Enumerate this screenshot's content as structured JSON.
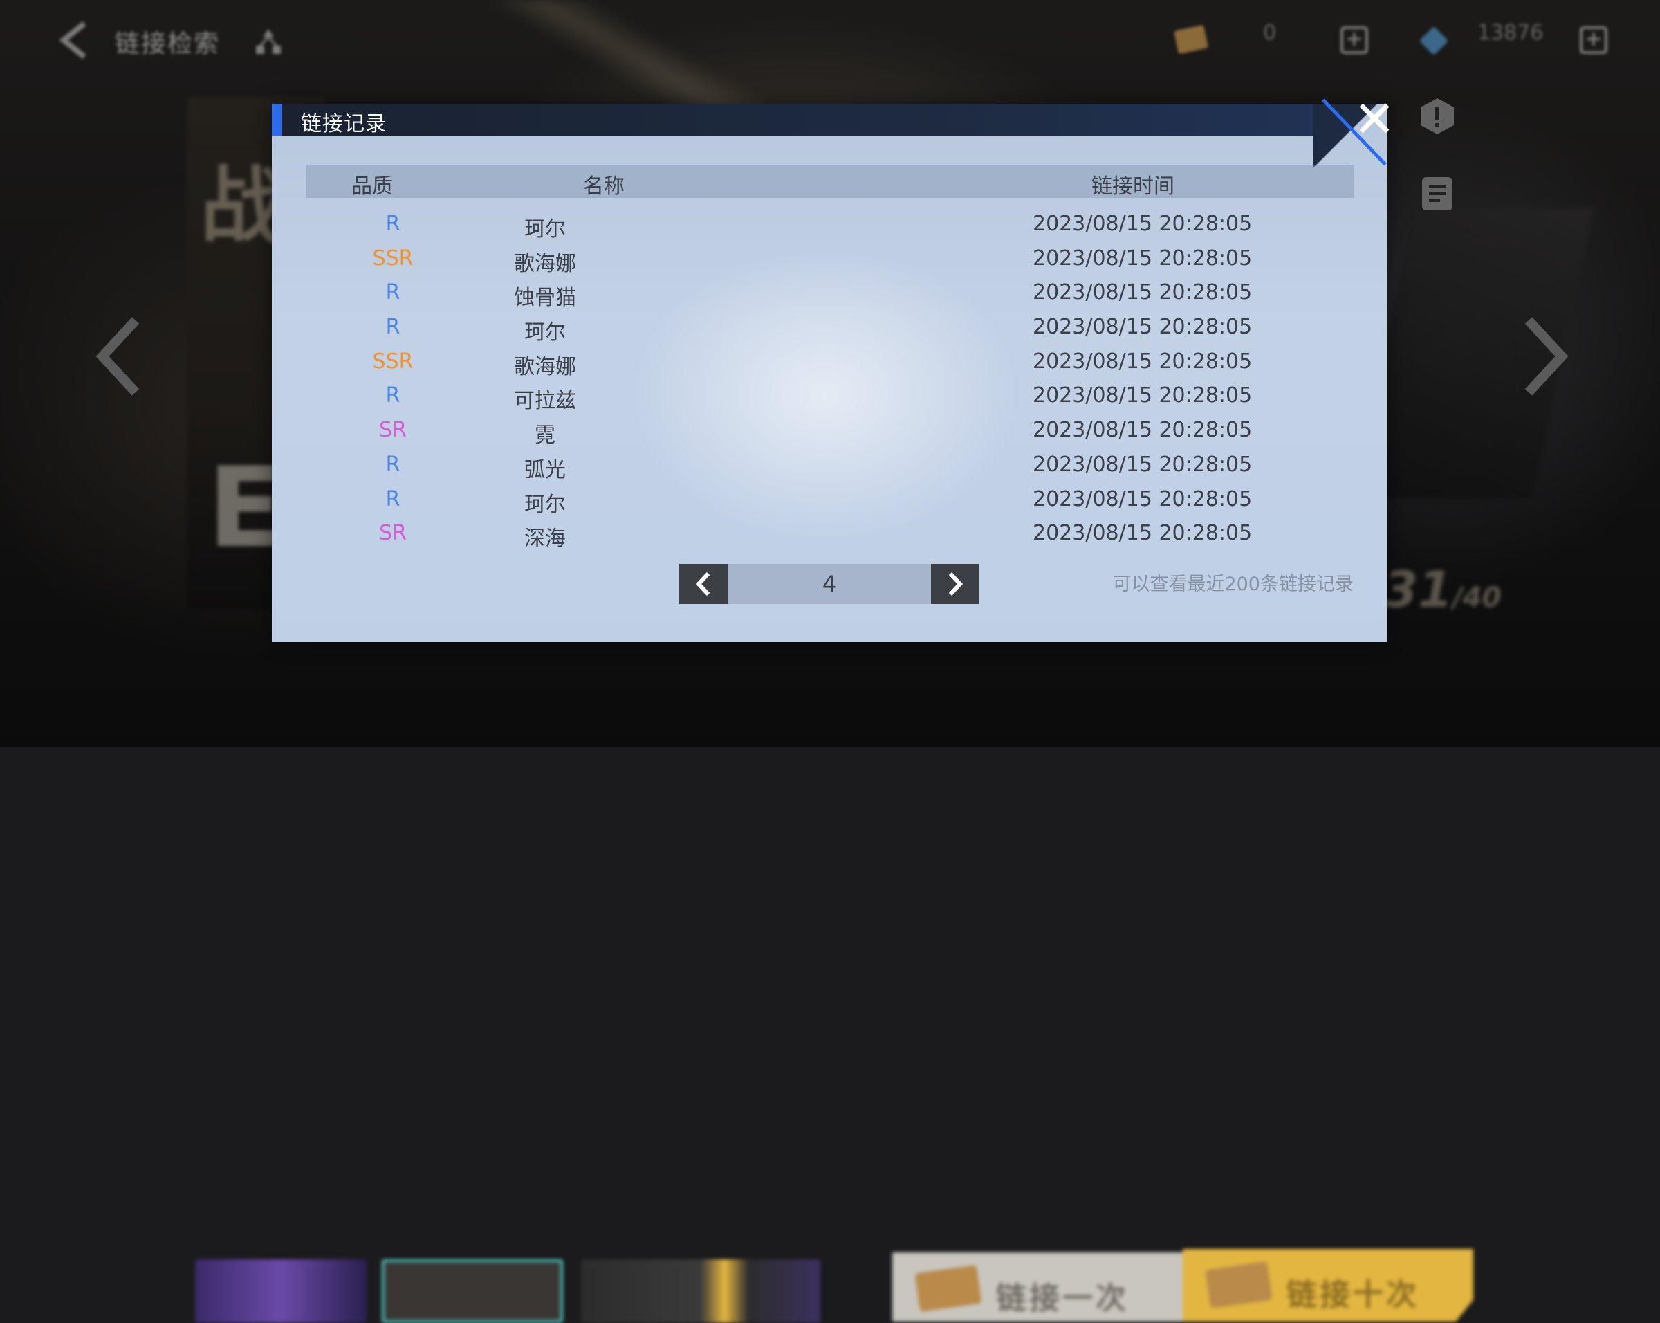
{
  "background": {
    "topbar": {
      "title": "链接检索",
      "currency1_value": "0",
      "currency2_value": "13876"
    },
    "counter": {
      "main": "31",
      "sub": "/40"
    },
    "pull_once_label": "链接一次",
    "pull_ten_label": "链接十次"
  },
  "modal": {
    "title": "链接记录",
    "headers": {
      "quality": "品质",
      "name": "名称",
      "time": "链接时间"
    },
    "rows": [
      {
        "quality": "R",
        "name": "珂尔",
        "time": "2023/08/15 20:28:05"
      },
      {
        "quality": "SSR",
        "name": "歌海娜",
        "time": "2023/08/15 20:28:05"
      },
      {
        "quality": "R",
        "name": "蚀骨猫",
        "time": "2023/08/15 20:28:05"
      },
      {
        "quality": "R",
        "name": "珂尔",
        "time": "2023/08/15 20:28:05"
      },
      {
        "quality": "SSR",
        "name": "歌海娜",
        "time": "2023/08/15 20:28:05"
      },
      {
        "quality": "R",
        "name": "可拉兹",
        "time": "2023/08/15 20:28:05"
      },
      {
        "quality": "SR",
        "name": "霓",
        "time": "2023/08/15 20:28:05"
      },
      {
        "quality": "R",
        "name": "弧光",
        "time": "2023/08/15 20:28:05"
      },
      {
        "quality": "R",
        "name": "珂尔",
        "time": "2023/08/15 20:28:05"
      },
      {
        "quality": "SR",
        "name": "深海",
        "time": "2023/08/15 20:28:05"
      }
    ],
    "pagination": {
      "current_page": "4"
    },
    "note": "可以查看最近200条链接记录"
  },
  "colors": {
    "R": "#4a86e8",
    "SR": "#d65bd6",
    "SSR": "#f0932b",
    "accent": "#2a6cf0"
  },
  "icons": {
    "back": "back-icon",
    "tree": "tree-icon",
    "close": "close-icon",
    "prev": "chevron-left-icon",
    "next": "chevron-right-icon"
  }
}
